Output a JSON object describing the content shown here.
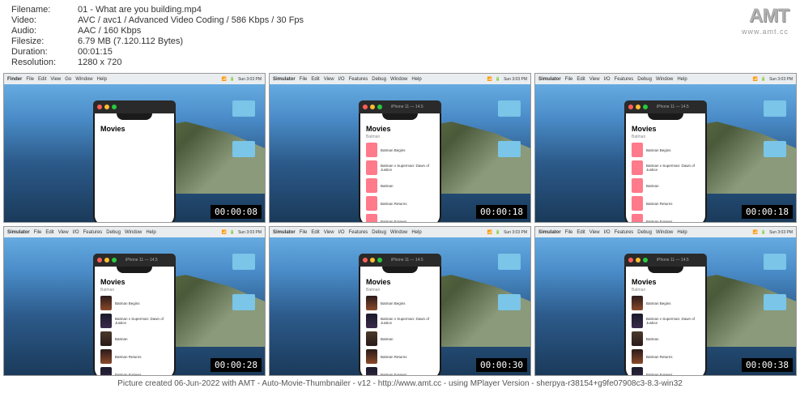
{
  "header": {
    "filename_label": "Filename:",
    "filename": "01 - What are you building.mp4",
    "video_label": "Video:",
    "video": "AVC / avc1 / Advanced Video Coding / 586 Kbps / 30 Fps",
    "audio_label": "Audio:",
    "audio": "AAC / 160 Kbps",
    "filesize_label": "Filesize:",
    "filesize": "6.79 MB (7.120.112 Bytes)",
    "duration_label": "Duration:",
    "duration": "00:01:15",
    "resolution_label": "Resolution:",
    "resolution": "1280 x 720"
  },
  "logo": {
    "text": "AMT",
    "sub": "www.amt.cc"
  },
  "menubar": {
    "finder": {
      "app": "Finder",
      "items": [
        "File",
        "Edit",
        "View",
        "Go",
        "Window",
        "Help"
      ]
    },
    "sim": {
      "app": "Simulator",
      "items": [
        "File",
        "Edit",
        "View",
        "I/O",
        "Features",
        "Debug",
        "Window",
        "Help"
      ]
    },
    "time": "Sun 3:03 PM"
  },
  "phone": {
    "device": "iPhone 11 — 14.5",
    "title": "Movies",
    "sub": "Batman",
    "movies": [
      "Batman Begins",
      "Batman v Superman: Dawn of Justice",
      "Batman",
      "Batman Returns",
      "Batman Forever"
    ]
  },
  "thumbs": [
    {
      "ts": "00:00:08",
      "menu": "finder",
      "content": "empty"
    },
    {
      "ts": "00:00:18",
      "menu": "sim",
      "content": "pink"
    },
    {
      "ts": "00:00:18",
      "menu": "sim",
      "content": "pink"
    },
    {
      "ts": "00:00:28",
      "menu": "sim",
      "content": "dark"
    },
    {
      "ts": "00:00:30",
      "menu": "sim",
      "content": "dark"
    },
    {
      "ts": "00:00:38",
      "menu": "sim",
      "content": "dark"
    }
  ],
  "footer": "Picture created 06-Jun-2022 with AMT - Auto-Movie-Thumbnailer - v12 - http://www.amt.cc - using MPlayer Version - sherpya-r38154+g9fe07908c3-8.3-win32"
}
